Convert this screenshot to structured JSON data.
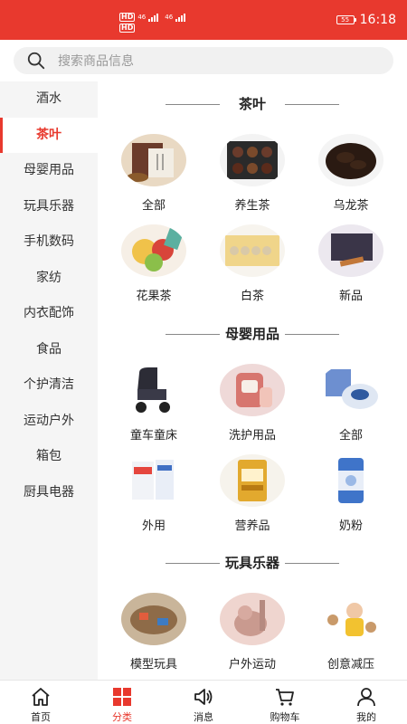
{
  "status": {
    "network_top": "46",
    "network_bottom": "46",
    "hd_label": "HD",
    "battery": "55",
    "time": "16:18"
  },
  "search": {
    "placeholder": "搜索商品信息"
  },
  "colors": {
    "accent": "#e8392e",
    "sidebar_bg": "#f5f5f5"
  },
  "sidebar": {
    "items": [
      {
        "label": "酒水"
      },
      {
        "label": "茶叶",
        "active": true
      },
      {
        "label": "母婴用品"
      },
      {
        "label": "玩具乐器"
      },
      {
        "label": "手机数码"
      },
      {
        "label": "家纺"
      },
      {
        "label": "内衣配饰"
      },
      {
        "label": "食品"
      },
      {
        "label": "个护清洁"
      },
      {
        "label": "运动户外"
      },
      {
        "label": "箱包"
      },
      {
        "label": "厨具电器"
      }
    ]
  },
  "sections": [
    {
      "title": "茶叶",
      "items": [
        {
          "label": "全部",
          "icon": "tea-gift-box-image"
        },
        {
          "label": "养生茶",
          "icon": "health-tea-image"
        },
        {
          "label": "乌龙茶",
          "icon": "oolong-tea-image"
        },
        {
          "label": "花果茶",
          "icon": "fruit-tea-image"
        },
        {
          "label": "白茶",
          "icon": "white-tea-image"
        },
        {
          "label": "新品",
          "icon": "new-tea-image"
        }
      ]
    },
    {
      "title": "母婴用品",
      "items": [
        {
          "label": "童车童床",
          "icon": "stroller-image"
        },
        {
          "label": "洗护用品",
          "icon": "baby-wash-image"
        },
        {
          "label": "全部",
          "icon": "baby-cream-image"
        },
        {
          "label": "外用",
          "icon": "external-use-image"
        },
        {
          "label": "营养品",
          "icon": "nutrition-image"
        },
        {
          "label": "奶粉",
          "icon": "milk-powder-image"
        }
      ]
    },
    {
      "title": "玩具乐器",
      "items": [
        {
          "label": "模型玩具",
          "icon": "model-toy-image"
        },
        {
          "label": "户外运动",
          "icon": "outdoor-toy-image"
        },
        {
          "label": "创意减压",
          "icon": "stress-toy-image"
        }
      ]
    }
  ],
  "bottomnav": {
    "items": [
      {
        "label": "首页",
        "icon": "home-icon"
      },
      {
        "label": "分类",
        "icon": "category-icon",
        "active": true
      },
      {
        "label": "消息",
        "icon": "speaker-icon"
      },
      {
        "label": "购物车",
        "icon": "cart-icon"
      },
      {
        "label": "我的",
        "icon": "profile-icon"
      }
    ]
  }
}
